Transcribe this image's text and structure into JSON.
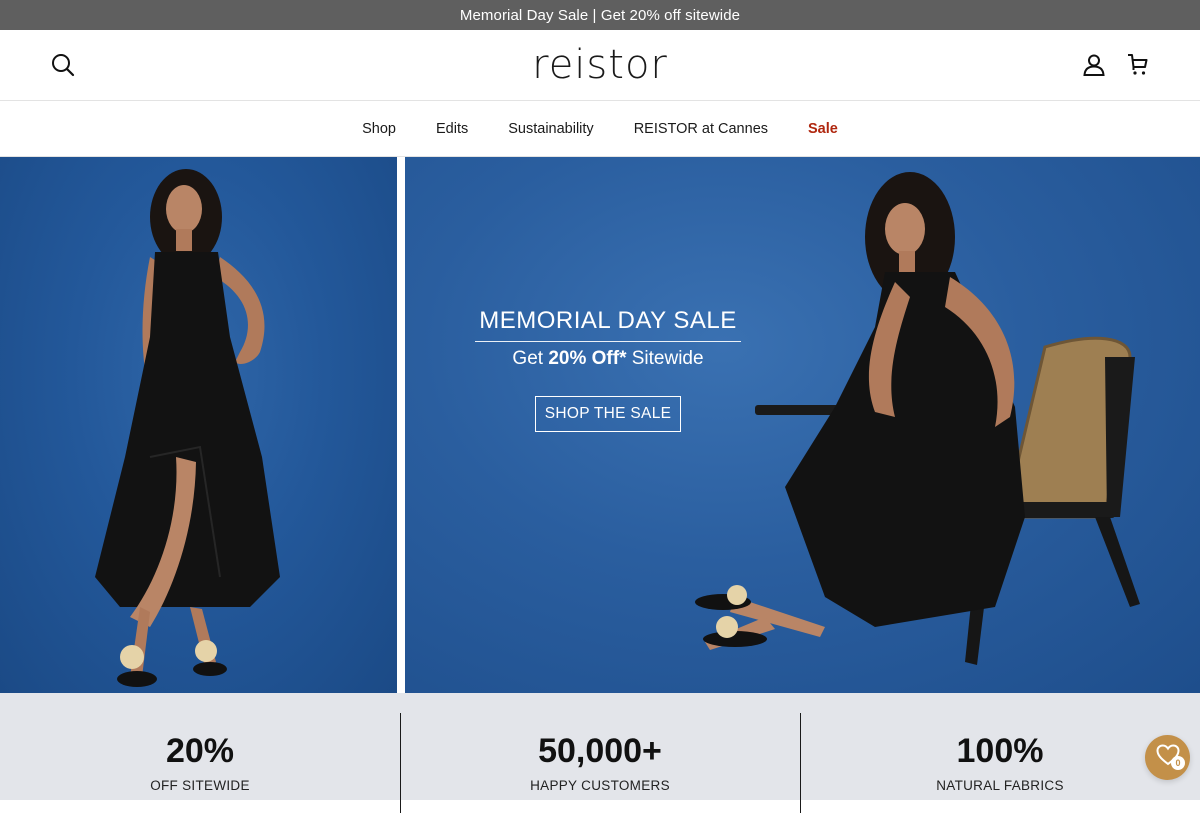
{
  "announcement": "Memorial Day Sale | Get 20% off sitewide",
  "header": {
    "logo": "reistor",
    "icons": [
      "search-icon",
      "account-icon",
      "cart-icon"
    ]
  },
  "nav": {
    "items": [
      {
        "label": "Shop"
      },
      {
        "label": "Edits"
      },
      {
        "label": "Sustainability"
      },
      {
        "label": "REISTOR at Cannes"
      },
      {
        "label": "Sale",
        "accent": "#b0270f"
      }
    ]
  },
  "hero": {
    "title": "MEMORIAL DAY SALE",
    "subtitle_prefix": "Get ",
    "subtitle_bold": "20% Off*",
    "subtitle_suffix": " Sitewide",
    "cta": "SHOP THE SALE"
  },
  "stats": [
    {
      "value": "20%",
      "label": "OFF SITEWIDE"
    },
    {
      "value": "50,000+",
      "label": "HAPPY CUSTOMERS"
    },
    {
      "value": "100%",
      "label": "NATURAL FABRICS"
    }
  ],
  "wishlist": {
    "count": "0",
    "icon": "heart-icon"
  },
  "colors": {
    "announcement_bg": "#5f5f5f",
    "sale": "#b0270f",
    "stats_bg": "#e3e5ea",
    "wishlist": "#c39049",
    "hero_blue": "#2a5e9f"
  }
}
